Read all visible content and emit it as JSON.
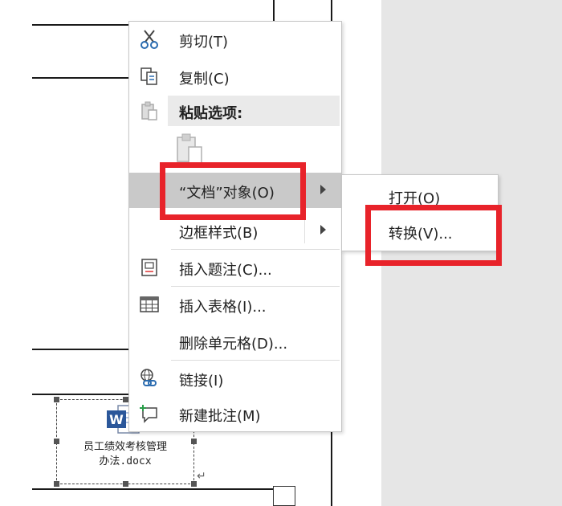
{
  "context_menu": {
    "items": [
      {
        "label": "剪切(T)",
        "icon": "scissors-icon"
      },
      {
        "label": "复制(C)",
        "icon": "copy-icon"
      },
      {
        "label": "粘贴选项:",
        "icon": "paste-icon"
      },
      {
        "label": "“文档”对象(O)",
        "has_submenu": true
      },
      {
        "label": "边框样式(B)",
        "has_submenu": true
      },
      {
        "label": "插入题注(C)...",
        "icon": "caption-icon"
      },
      {
        "label": "插入表格(I)...",
        "icon": "table-icon"
      },
      {
        "label": "删除单元格(D)..."
      },
      {
        "label": "链接(I)",
        "icon": "link-icon"
      },
      {
        "label": "新建批注(M)",
        "icon": "comment-icon"
      }
    ]
  },
  "submenu": {
    "items": [
      {
        "label": "打开(O)"
      },
      {
        "label": "转换(V)..."
      }
    ]
  },
  "document": {
    "embedded_object_label_line1": "员工绩效考核管理",
    "embedded_object_label_line2": "办法.docx",
    "object_icon": "word-document-icon"
  },
  "colors": {
    "highlight_box": "#e8232a",
    "menu_hover": "#c9c9c9",
    "side_panel": "#e6e6e6"
  }
}
